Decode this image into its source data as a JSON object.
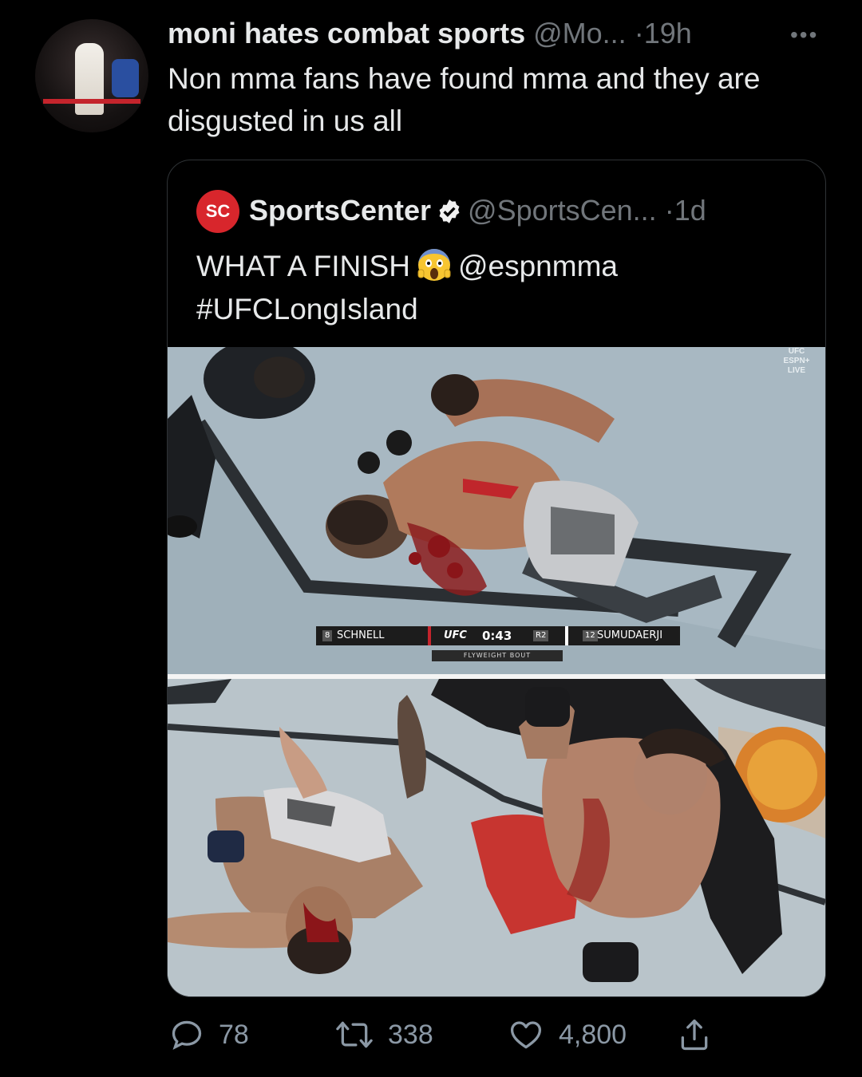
{
  "tweet": {
    "author_name": "moni hates combat sports",
    "author_handle": "@Mo...",
    "separator": "·",
    "time": "19h",
    "more": "•••",
    "text": "Non mma fans have found mma and they are disgusted in us all"
  },
  "quote": {
    "logo_text": "SC",
    "author_name": "SportsCenter",
    "author_handle": "@SportsCen...",
    "separator": "·",
    "time": "1d",
    "text_part1": "WHAT A FINISH",
    "mention": "@espnmma",
    "hashtag": "#UFCLongIsland",
    "media": {
      "live_badge": [
        "UFC",
        "ESPN+",
        "LIVE"
      ],
      "scorebug": {
        "fighter_left": "SCHNELL",
        "fighter_left_rank": "8",
        "brand": "UFC",
        "clock": "0:43",
        "round": "R2",
        "fighter_right": "SUMUDAERJI",
        "fighter_right_rank": "12",
        "bout": "FLYWEIGHT BOUT"
      }
    }
  },
  "actions": {
    "replies": "78",
    "retweets": "338",
    "likes": "4,800"
  },
  "colors": {
    "background": "#000000",
    "text": "#e7e9ea",
    "muted": "#71767b",
    "verified": "#f0f0f0",
    "sc_red": "#d8262c"
  }
}
